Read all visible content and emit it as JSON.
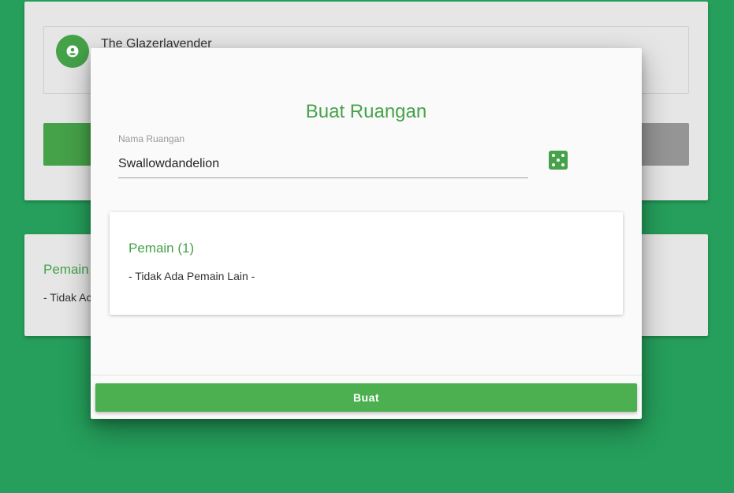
{
  "background": {
    "player": {
      "name": "The Glazerlavender",
      "avatar_icon": "account-circle-icon"
    },
    "players_heading": "Pemain",
    "players_empty": "- Tidak Ac"
  },
  "modal": {
    "title": "Buat Ruangan",
    "room_field": {
      "label": "Nama Ruangan",
      "value": "Swallowdandelion"
    },
    "randomize_icon": "dice-icon",
    "players": {
      "title": "Pemain (1)",
      "empty_text": "- Tidak Ada Pemain Lain -"
    },
    "create_button_label": "Buat"
  },
  "colors": {
    "page_background": "#259f5b",
    "accent": "#4caf50",
    "card_background": "#e6e6e6",
    "modal_background": "#fafafa"
  }
}
